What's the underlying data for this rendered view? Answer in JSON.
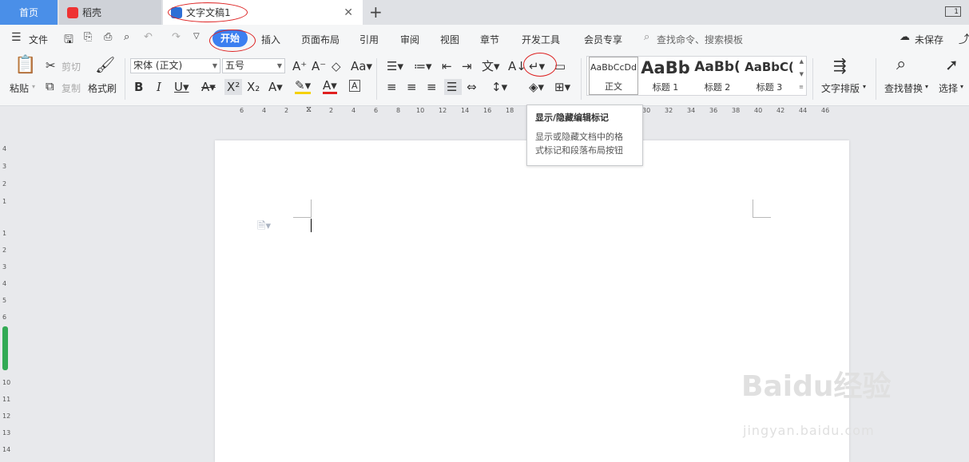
{
  "tabs": {
    "home": "首页",
    "daoke": "稻壳",
    "doc": "文字文稿1",
    "window_count": "1"
  },
  "menu": {
    "file": "文件",
    "items": [
      "开始",
      "插入",
      "页面布局",
      "引用",
      "审阅",
      "视图",
      "章节",
      "开发工具",
      "会员专享"
    ],
    "search": "查找命令、搜索模板",
    "unsaved": "未保存"
  },
  "ribbon": {
    "paste": "粘贴",
    "cut": "剪切",
    "copy": "复制",
    "format_painter": "格式刷",
    "font_name": "宋体 (正文)",
    "font_size": "五号",
    "styles": [
      {
        "sample": "AaBbCcDd",
        "label": "正文"
      },
      {
        "sample": "AaBb",
        "label": "标题 1"
      },
      {
        "sample": "AaBb(",
        "label": "标题 2"
      },
      {
        "sample": "AaBbC(",
        "label": "标题 3"
      }
    ],
    "text_layout": "文字排版",
    "find_replace": "查找替换",
    "select": "选择"
  },
  "tooltip": {
    "title": "显示/隐藏编辑标记",
    "desc1": "显示或隐藏文档中的格",
    "desc2": "式标记和段落布局按钮"
  },
  "ruler_h": [
    "6",
    "4",
    "2",
    "2",
    "4",
    "6",
    "8",
    "10",
    "12",
    "14",
    "16",
    "18",
    "30",
    "32",
    "34",
    "36",
    "38",
    "40",
    "42",
    "44",
    "46"
  ],
  "ruler_v": [
    "4",
    "3",
    "2",
    "1",
    "1",
    "2",
    "3",
    "4",
    "5",
    "6",
    "7",
    "8",
    "9",
    "10",
    "11",
    "12",
    "13",
    "14"
  ],
  "watermark": {
    "brand": "Baidu经验",
    "url": "jingyan.baidu.com"
  }
}
